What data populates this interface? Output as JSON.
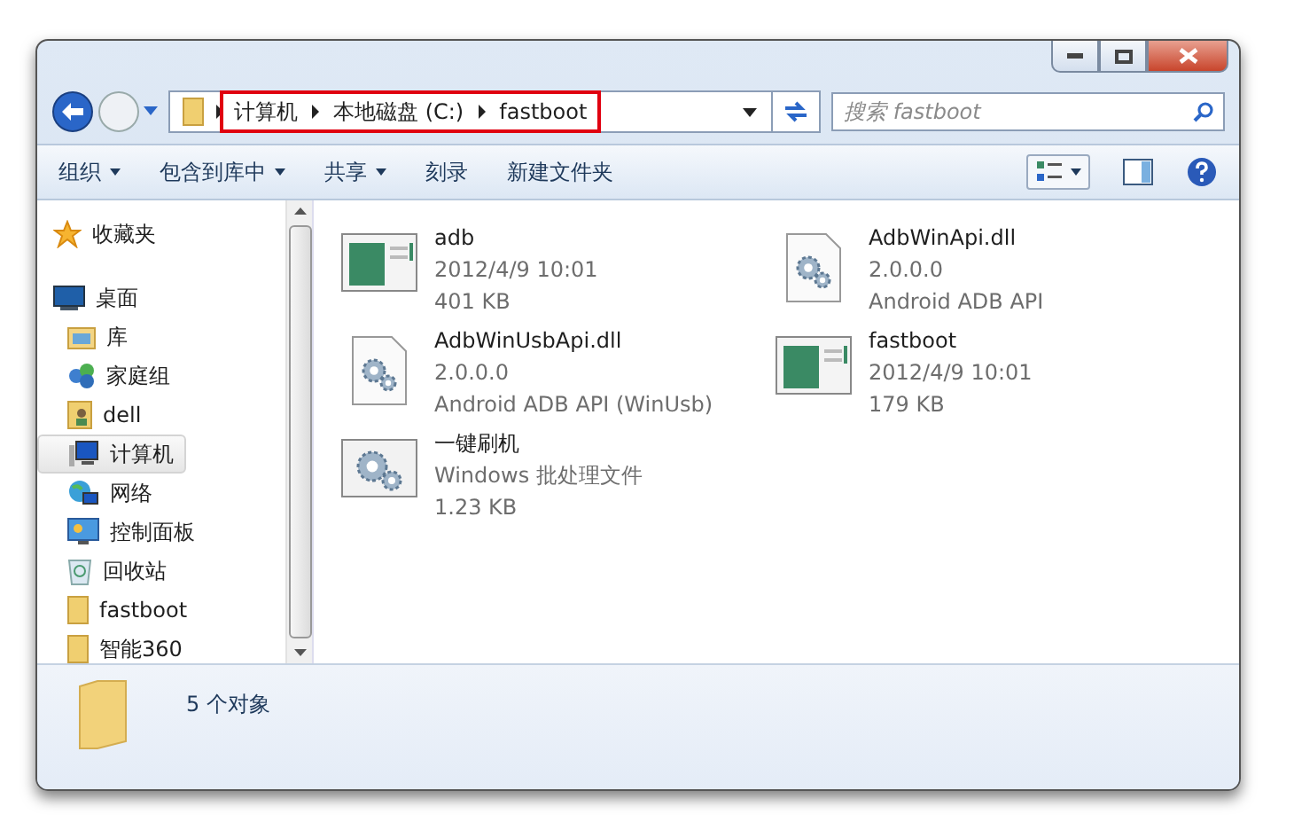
{
  "address_bar": {
    "highlighted": true,
    "crumbs": [
      "计算机",
      "本地磁盘 (C:)",
      "fastboot"
    ]
  },
  "search": {
    "placeholder": "搜索 fastboot"
  },
  "toolbar": {
    "items": [
      {
        "label": "组织",
        "has_menu": true
      },
      {
        "label": "包含到库中",
        "has_menu": true
      },
      {
        "label": "共享",
        "has_menu": true
      },
      {
        "label": "刻录",
        "has_menu": false
      },
      {
        "label": "新建文件夹",
        "has_menu": false
      }
    ]
  },
  "sidebar": {
    "items": [
      {
        "label": "收藏夹",
        "kind": "star",
        "selected": false
      },
      {
        "label": "桌面",
        "kind": "desktop",
        "selected": false,
        "children": [
          {
            "label": "库",
            "kind": "library",
            "selected": false
          },
          {
            "label": "家庭组",
            "kind": "homegroup",
            "selected": false
          },
          {
            "label": "dell",
            "kind": "user",
            "selected": false
          },
          {
            "label": "计算机",
            "kind": "computer",
            "selected": true
          },
          {
            "label": "网络",
            "kind": "network",
            "selected": false
          },
          {
            "label": "控制面板",
            "kind": "control",
            "selected": false
          },
          {
            "label": "回收站",
            "kind": "recycle",
            "selected": false
          },
          {
            "label": "fastboot",
            "kind": "folder",
            "selected": false
          },
          {
            "label": "智能360",
            "kind": "folder",
            "selected": false
          }
        ]
      }
    ]
  },
  "files": [
    {
      "name": "adb",
      "kind": "exe",
      "line_1": "2012/4/9 10:01",
      "line_2": "401 KB"
    },
    {
      "name": "AdbWinApi.dll",
      "kind": "dll",
      "line_1": "2.0.0.0",
      "line_2": "Android ADB API"
    },
    {
      "name": "AdbWinUsbApi.dll",
      "kind": "dll",
      "line_1": "2.0.0.0",
      "line_2": "Android ADB API (WinUsb)"
    },
    {
      "name": "fastboot",
      "kind": "exe",
      "line_1": "2012/4/9 10:01",
      "line_2": "179 KB"
    },
    {
      "name": "一键刷机",
      "kind": "bat",
      "line_1": "Windows 批处理文件",
      "line_2": "1.23 KB"
    }
  ],
  "status_bar": {
    "text": "5 个对象"
  }
}
